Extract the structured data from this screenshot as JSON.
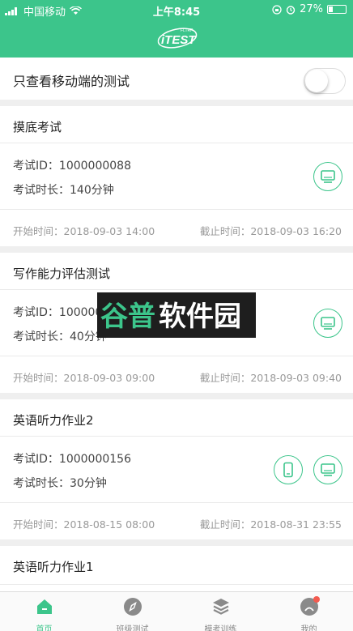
{
  "status_bar": {
    "carrier": "中国移动",
    "time": "上午8:45",
    "battery": "27%",
    "battery_level": 0.27
  },
  "header": {
    "logo_text": "iTEST",
    "logo_small": "FLTRP"
  },
  "filter": {
    "label": "只查看移动端的测试",
    "enabled": false
  },
  "exams": [
    {
      "title": "摸底考试",
      "id_label": "考试ID：1000000088",
      "duration_label": "考试时长：140分钟",
      "start": "开始时间：2018-09-03 14:00",
      "end": "截止时间：2018-09-03 16:20",
      "icons": [
        "desktop-icon"
      ]
    },
    {
      "title": "写作能力评估测试",
      "id_label": "考试ID：1000000",
      "duration_label": "考试时长：40分钟",
      "start": "开始时间：2018-09-03 09:00",
      "end": "截止时间：2018-09-03 09:40",
      "icons": [
        "desktop-icon"
      ]
    },
    {
      "title": "英语听力作业2",
      "id_label": "考试ID：1000000156",
      "duration_label": "考试时长：30分钟",
      "start": "开始时间：2018-08-15 08:00",
      "end": "截止时间：2018-08-31 23:55",
      "icons": [
        "mobile-icon",
        "desktop-icon"
      ]
    },
    {
      "title": "英语听力作业1"
    }
  ],
  "watermark": "谷普软件园",
  "tabs": [
    {
      "label": "首页",
      "icon": "home-icon",
      "active": true
    },
    {
      "label": "班级测试",
      "icon": "compass-icon",
      "active": false
    },
    {
      "label": "模考训练",
      "icon": "layers-icon",
      "active": false
    },
    {
      "label": "我的",
      "icon": "profile-icon",
      "active": false
    }
  ],
  "colors": {
    "accent": "#3cc58b",
    "badge": "#f35b4f"
  }
}
